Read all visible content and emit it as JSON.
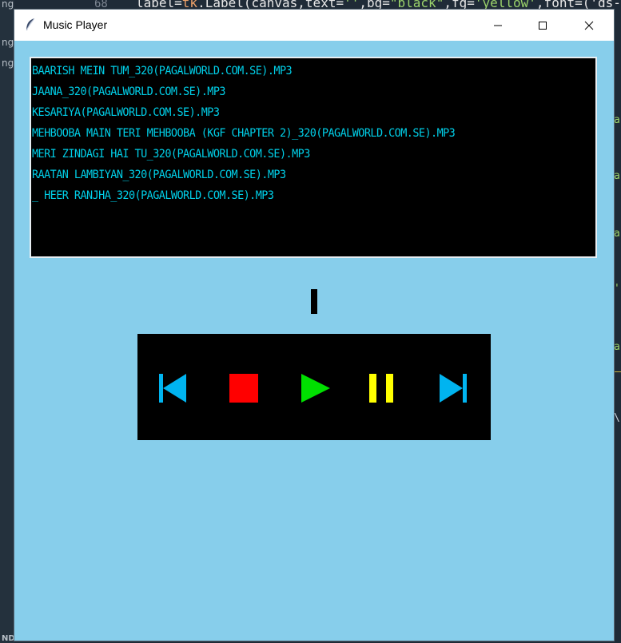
{
  "background_editor": {
    "line_number": "68",
    "code_prefix": "label=",
    "code_tk": "tk",
    "code_mid": ".Label(canvas,text=",
    "code_str1": "''",
    "code_bg": ",bg=",
    "code_str2": "\"black\"",
    "code_fg": ",fg=",
    "code_str3": "'yellow'",
    "code_font": ",font=('ds-",
    "side_words": [
      "ng",
      "ng",
      "ng"
    ],
    "bottom_word": "NDS",
    "right_chars": [
      "a",
      "a",
      "a",
      "'",
      "a",
      "\\"
    ]
  },
  "window": {
    "title": "Music Player",
    "icon": "feather-icon"
  },
  "playlist": {
    "tracks": [
      "BAARISH MEIN TUM_320(PAGALWORLD.COM.SE).MP3",
      "JAANA_320(PAGALWORLD.COM.SE).MP3",
      "KESARIYA(PAGALWORLD.COM.SE).MP3",
      "MEHBOOBA MAIN TERI MEHBOOBA (KGF CHAPTER 2)_320(PAGALWORLD.COM.SE).MP3",
      "MERI ZINDAGI HAI TU_320(PAGALWORLD.COM.SE).MP3",
      "RAATAN LAMBIYAN_320(PAGALWORLD.COM.SE).MP3",
      "_ HEER RANJHA_320(PAGALWORLD.COM.SE).MP3"
    ],
    "text_color": "#00cfe8",
    "background": "#000000"
  },
  "controls": {
    "buttons": [
      {
        "name": "previous",
        "icon": "skip-previous-icon",
        "color": "#00b4f0"
      },
      {
        "name": "stop",
        "icon": "stop-icon",
        "color": "#ff0000"
      },
      {
        "name": "play",
        "icon": "play-icon",
        "color": "#00e000"
      },
      {
        "name": "pause",
        "icon": "pause-icon",
        "color": "#ffff00"
      },
      {
        "name": "next",
        "icon": "skip-next-icon",
        "color": "#00b4f0"
      }
    ]
  },
  "colors": {
    "window_bg": "#87ceeb",
    "panel_bg": "#000000"
  }
}
